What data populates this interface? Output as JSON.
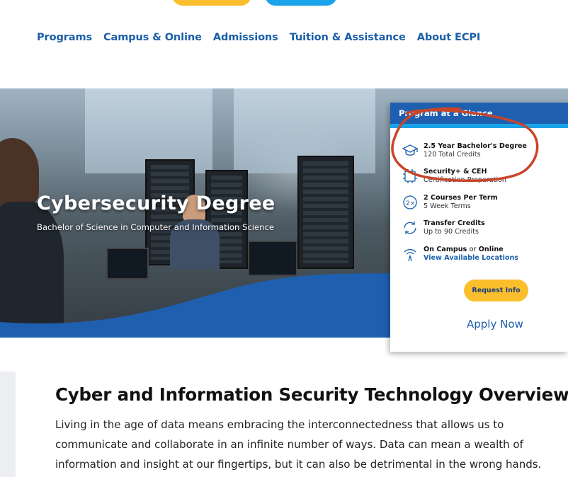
{
  "nav": {
    "items": [
      {
        "label": "Programs"
      },
      {
        "label": "Campus & Online"
      },
      {
        "label": "Admissions"
      },
      {
        "label": "Tuition & Assistance"
      },
      {
        "label": "About ECPI"
      }
    ]
  },
  "hero": {
    "title": "Cybersecurity Degree",
    "subtitle": "Bachelor of Science in Computer and Information Science"
  },
  "glance": {
    "heading": "Program at a Glance",
    "items": [
      {
        "icon": "graduation-cap-icon",
        "title": "2.5 Year Bachelor's Degree",
        "detail": "120 Total Credits"
      },
      {
        "icon": "certificate-chip-icon",
        "title": "Security+ & CEH",
        "detail": "Certification Preparation"
      },
      {
        "icon": "two-times-icon",
        "title": "2 Courses Per Term",
        "detail": "5 Week Terms"
      },
      {
        "icon": "transfer-arrows-icon",
        "title": "Transfer Credits",
        "detail": "Up to 90 Credits"
      },
      {
        "icon": "wifi-location-icon",
        "title_a": "On Campus",
        "title_or": "or",
        "title_b": "Online",
        "detail": "View Available Locations"
      }
    ],
    "request_label": "Request Info",
    "apply_label": "Apply Now"
  },
  "overview": {
    "title": "Cyber and Information Security Technology Overview",
    "body": "Living in the age of data means embracing the interconnectedness that allows us to communicate and collaborate in an infinite number of ways. Data can mean a wealth of information and insight at our fingertips, but it can also be detrimental in the wrong hands."
  },
  "colors": {
    "brand_blue": "#1b5fa8",
    "accent_yellow": "#fbbf2d",
    "accent_light_blue": "#1aa3e8",
    "annotation_red": "#c8452a"
  }
}
